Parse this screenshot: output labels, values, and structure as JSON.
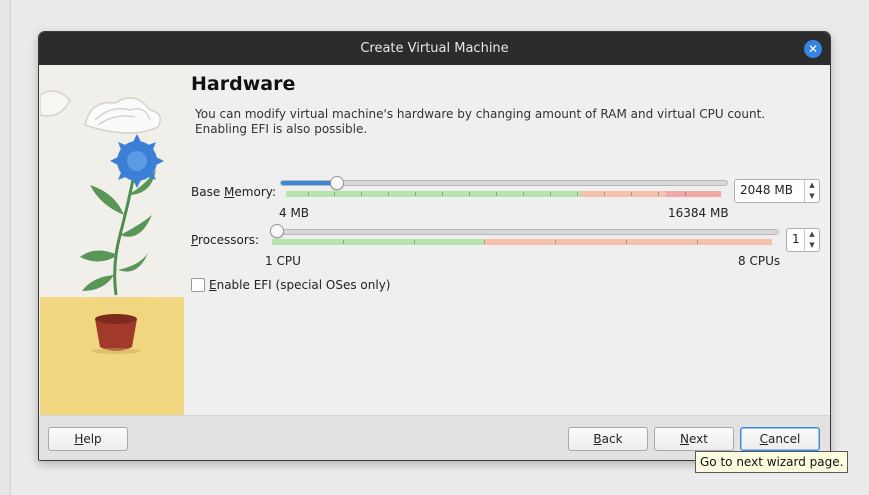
{
  "window": {
    "title": "Create Virtual Machine"
  },
  "page": {
    "heading": "Hardware",
    "description_line1": "You can modify virtual machine's hardware by changing amount of RAM and virtual CPU count.",
    "description_line2": "Enabling EFI is also possible."
  },
  "memory": {
    "label_prefix": "Base ",
    "label_mnemonic": "M",
    "label_suffix": "emory:",
    "min_label": "4 MB",
    "max_label": "16384 MB",
    "value": "2048 MB",
    "fraction": 0.125
  },
  "processors": {
    "label_mnemonic": "P",
    "label_suffix": "rocessors:",
    "min_label": "1 CPU",
    "max_label": "8 CPUs",
    "value": "1",
    "fraction": 0
  },
  "efi": {
    "label_mnemonic": "E",
    "label_suffix": "nable EFI (special OSes only)",
    "checked": false
  },
  "buttons": {
    "help_mnemonic": "H",
    "help_rest": "elp",
    "back_mnemonic": "B",
    "back_rest": "ack",
    "next_mnemonic": "N",
    "next_rest": "ext",
    "cancel_mnemonic": "C",
    "cancel_rest": "ancel"
  },
  "tooltip": "Go to next wizard page.",
  "colors": {
    "accent": "#3d86d8",
    "safe": "#b9e4ad",
    "warn": "#f2c2ad",
    "danger": "#f0a8a8"
  }
}
